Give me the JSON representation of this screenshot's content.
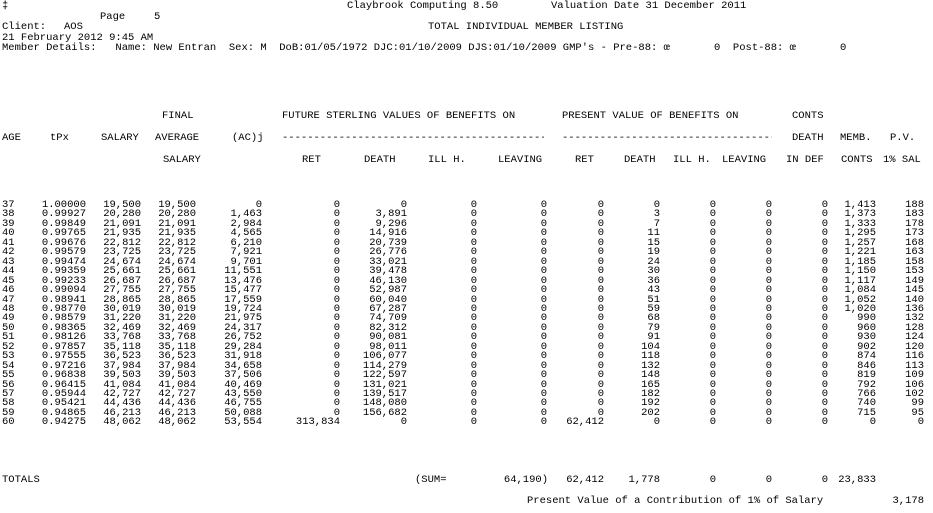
{
  "header": {
    "corner_mark": "‡",
    "program": "Claybrook Computing 8.50",
    "valuation": "Valuation Date 31 December 2011",
    "page_label": "Page",
    "page_number": "5",
    "client_label": "Client:",
    "client": "AOS",
    "title": "TOTAL INDIVIDUAL MEMBER LISTING",
    "run_date": "21 February 2012 9:45 AM",
    "member_details": "Member Details:   Name: New Entran  Sex: M  DoB:01/05/1972 DJC:01/10/2009 DJS:01/10/2009 GMP's - Pre-88: œ       0  Post-88: œ       0"
  },
  "columns": {
    "group_future": "FUTURE STERLING VALUES OF BENEFITS ON",
    "group_present": "PRESENT VALUE OF BENEFITS ON",
    "group_conts": "CONTS",
    "final": "FINAL",
    "age": "AGE",
    "tpx": "tPx",
    "salary": "SALARY",
    "average": "AVERAGE",
    "acj": "(AC)j",
    "death_top": "DEATH",
    "memb": "MEMB.",
    "pv": "P.V.",
    "salary2": "SALARY",
    "ret": "RET",
    "death": "DEATH",
    "illh": "ILL H.",
    "leaving": "LEAVING",
    "ret2": "RET",
    "death2": "DEATH",
    "illh2": "ILL H.",
    "leaving2": "LEAVING",
    "indef": "IN DEF",
    "conts": "CONTS",
    "pct": "1% SAL"
  },
  "rows": [
    [
      "37",
      "1.00000",
      "19,500",
      "19,500",
      "0",
      "0",
      "0",
      "0",
      "0",
      "0",
      "0",
      "0",
      "0",
      "0",
      "1,413",
      "188"
    ],
    [
      "38",
      "0.99927",
      "20,280",
      "20,280",
      "1,463",
      "0",
      "3,891",
      "0",
      "0",
      "0",
      "3",
      "0",
      "0",
      "0",
      "1,373",
      "183"
    ],
    [
      "39",
      "0.99849",
      "21,091",
      "21,091",
      "2,984",
      "0",
      "9,296",
      "0",
      "0",
      "0",
      "7",
      "0",
      "0",
      "0",
      "1,333",
      "178"
    ],
    [
      "40",
      "0.99765",
      "21,935",
      "21,935",
      "4,565",
      "0",
      "14,916",
      "0",
      "0",
      "0",
      "11",
      "0",
      "0",
      "0",
      "1,295",
      "173"
    ],
    [
      "41",
      "0.99676",
      "22,812",
      "22,812",
      "6,210",
      "0",
      "20,739",
      "0",
      "0",
      "0",
      "15",
      "0",
      "0",
      "0",
      "1,257",
      "168"
    ],
    [
      "42",
      "0.99579",
      "23,725",
      "23,725",
      "7,921",
      "0",
      "26,776",
      "0",
      "0",
      "0",
      "19",
      "0",
      "0",
      "0",
      "1,221",
      "163"
    ],
    [
      "43",
      "0.99474",
      "24,674",
      "24,674",
      "9,701",
      "0",
      "33,021",
      "0",
      "0",
      "0",
      "24",
      "0",
      "0",
      "0",
      "1,185",
      "158"
    ],
    [
      "44",
      "0.99359",
      "25,661",
      "25,661",
      "11,551",
      "0",
      "39,478",
      "0",
      "0",
      "0",
      "30",
      "0",
      "0",
      "0",
      "1,150",
      "153"
    ],
    [
      "45",
      "0.99233",
      "26,687",
      "26,687",
      "13,476",
      "0",
      "46,130",
      "0",
      "0",
      "0",
      "36",
      "0",
      "0",
      "0",
      "1,117",
      "149"
    ],
    [
      "46",
      "0.99094",
      "27,755",
      "27,755",
      "15,477",
      "0",
      "52,987",
      "0",
      "0",
      "0",
      "43",
      "0",
      "0",
      "0",
      "1,084",
      "145"
    ],
    [
      "47",
      "0.98941",
      "28,865",
      "28,865",
      "17,559",
      "0",
      "60,040",
      "0",
      "0",
      "0",
      "51",
      "0",
      "0",
      "0",
      "1,052",
      "140"
    ],
    [
      "48",
      "0.98770",
      "30,019",
      "30,019",
      "19,724",
      "0",
      "67,287",
      "0",
      "0",
      "0",
      "59",
      "0",
      "0",
      "0",
      "1,020",
      "136"
    ],
    [
      "49",
      "0.98579",
      "31,220",
      "31,220",
      "21,975",
      "0",
      "74,709",
      "0",
      "0",
      "0",
      "68",
      "0",
      "0",
      "0",
      "990",
      "132"
    ],
    [
      "50",
      "0.98365",
      "32,469",
      "32,469",
      "24,317",
      "0",
      "82,312",
      "0",
      "0",
      "0",
      "79",
      "0",
      "0",
      "0",
      "960",
      "128"
    ],
    [
      "51",
      "0.98126",
      "33,768",
      "33,768",
      "26,752",
      "0",
      "90,081",
      "0",
      "0",
      "0",
      "91",
      "0",
      "0",
      "0",
      "930",
      "124"
    ],
    [
      "52",
      "0.97857",
      "35,118",
      "35,118",
      "29,284",
      "0",
      "98,011",
      "0",
      "0",
      "0",
      "104",
      "0",
      "0",
      "0",
      "902",
      "120"
    ],
    [
      "53",
      "0.97555",
      "36,523",
      "36,523",
      "31,918",
      "0",
      "106,077",
      "0",
      "0",
      "0",
      "118",
      "0",
      "0",
      "0",
      "874",
      "116"
    ],
    [
      "54",
      "0.97216",
      "37,984",
      "37,984",
      "34,658",
      "0",
      "114,279",
      "0",
      "0",
      "0",
      "132",
      "0",
      "0",
      "0",
      "846",
      "113"
    ],
    [
      "55",
      "0.96838",
      "39,503",
      "39,503",
      "37,506",
      "0",
      "122,597",
      "0",
      "0",
      "0",
      "148",
      "0",
      "0",
      "0",
      "819",
      "109"
    ],
    [
      "56",
      "0.96415",
      "41,084",
      "41,084",
      "40,469",
      "0",
      "131,021",
      "0",
      "0",
      "0",
      "165",
      "0",
      "0",
      "0",
      "792",
      "106"
    ],
    [
      "57",
      "0.95944",
      "42,727",
      "42,727",
      "43,550",
      "0",
      "139,517",
      "0",
      "0",
      "0",
      "182",
      "0",
      "0",
      "0",
      "766",
      "102"
    ],
    [
      "58",
      "0.95421",
      "44,436",
      "44,436",
      "46,755",
      "0",
      "148,080",
      "0",
      "0",
      "0",
      "192",
      "0",
      "0",
      "0",
      "740",
      "99"
    ],
    [
      "59",
      "0.94865",
      "46,213",
      "46,213",
      "50,088",
      "0",
      "156,682",
      "0",
      "0",
      "0",
      "202",
      "0",
      "0",
      "0",
      "715",
      "95"
    ],
    [
      "60",
      "0.94275",
      "48,062",
      "48,062",
      "53,554",
      "313,834",
      "0",
      "0",
      "0",
      "62,412",
      "0",
      "0",
      "0",
      "0",
      "0",
      "0"
    ]
  ],
  "totals": {
    "label": "TOTALS",
    "sum_label": "(SUM=",
    "sum_value": "64,190)",
    "ret": "62,412",
    "death": "1,778",
    "illh": "0",
    "leaving": "0",
    "indef": "0",
    "conts": "23,833"
  },
  "footer": {
    "label": "Present Value of a Contribution of 1% of Salary",
    "value": "3,178"
  }
}
